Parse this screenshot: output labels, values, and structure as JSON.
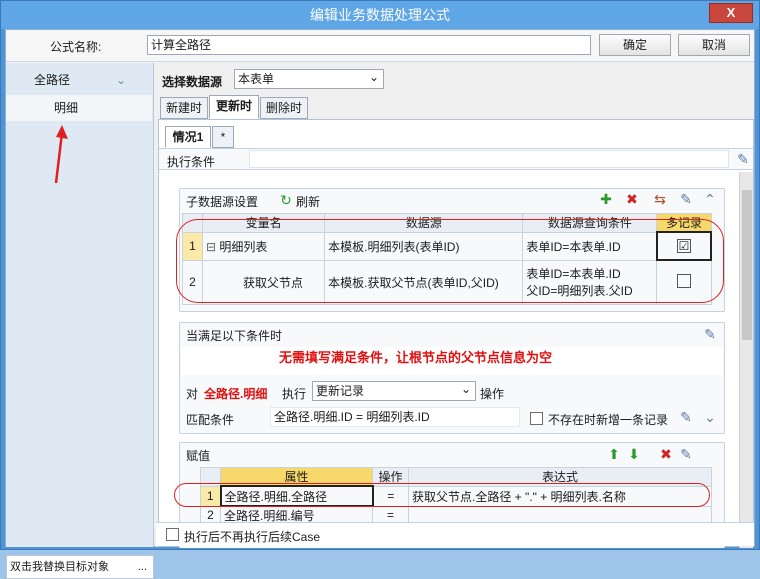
{
  "window": {
    "title": "编辑业务数据处理公式",
    "close_glyph": "X"
  },
  "topbar": {
    "formula_name_label": "公式名称:",
    "formula_name_value": "计算全路径",
    "ok_label": "确定",
    "cancel_label": "取消"
  },
  "tree": {
    "root_label": "全路径",
    "child_label": "明细",
    "bottom_hint": "双击我替换目标对象",
    "bottom_more": "..."
  },
  "datasource": {
    "label": "选择数据源",
    "value": "本表单"
  },
  "tabs": [
    "新建时",
    "更新时",
    "删除时"
  ],
  "subtabs": [
    "情况1",
    "*"
  ],
  "exec_condition_label": "执行条件",
  "subsource": {
    "title": "子数据源设置",
    "refresh_label": "刷新",
    "columns": [
      "变量名",
      "数据源",
      "数据源查询条件",
      "多记录"
    ],
    "rows": [
      {
        "idx": "1",
        "expander": "⊟",
        "name": "明细列表",
        "source": "本模板.明细列表(表单ID)",
        "cond1": "表单ID=本表单.ID",
        "cond2": "",
        "multi": "☑"
      },
      {
        "idx": "2",
        "expander": "",
        "name": "获取父节点",
        "source": "本模板.获取父节点(表单ID,父ID)",
        "cond1": "表单ID=本表单.ID",
        "cond2": "父ID=明细列表.父ID",
        "multi": ""
      }
    ]
  },
  "cond_section": {
    "title": "当满足以下条件时",
    "annotation": "无需填写满足条件，让根节点的父节点信息为空",
    "for_label": "对",
    "target": "全路径.明细",
    "exec_label": "执行",
    "exec_value": "更新记录",
    "op_label": "操作",
    "match_label": "匹配条件",
    "match_value": "全路径.明细.ID = 明细列表.ID",
    "insert_label": "不存在时新增一条记录"
  },
  "assign": {
    "title": "赋值",
    "columns": [
      "属性",
      "操作",
      "表达式"
    ],
    "rows": [
      {
        "idx": "1",
        "prop": "全路径.明细.全路径",
        "op": "=",
        "expr": "获取父节点.全路径 + \".\" + 明细列表.名称"
      },
      {
        "idx": "2",
        "prop": "全路径.明细.编号",
        "op": "=",
        "expr": ""
      }
    ]
  },
  "footer": {
    "no_continue_label": "执行后不再执行后续Case"
  },
  "icons": {
    "chevron": "⌄",
    "edit": "✎",
    "add": "✚",
    "delete": "✖",
    "refresh": "↻",
    "up": "⬆",
    "down": "⬇",
    "collapse": "⌃",
    "expand": "⌄",
    "arrow": "↑",
    "dropdown": "⌄",
    "import": "⇆"
  },
  "colors": {
    "accent": "#5ea6e6",
    "add": "#2a9a2a",
    "delete": "#d32323",
    "annotation": "#e01010"
  }
}
